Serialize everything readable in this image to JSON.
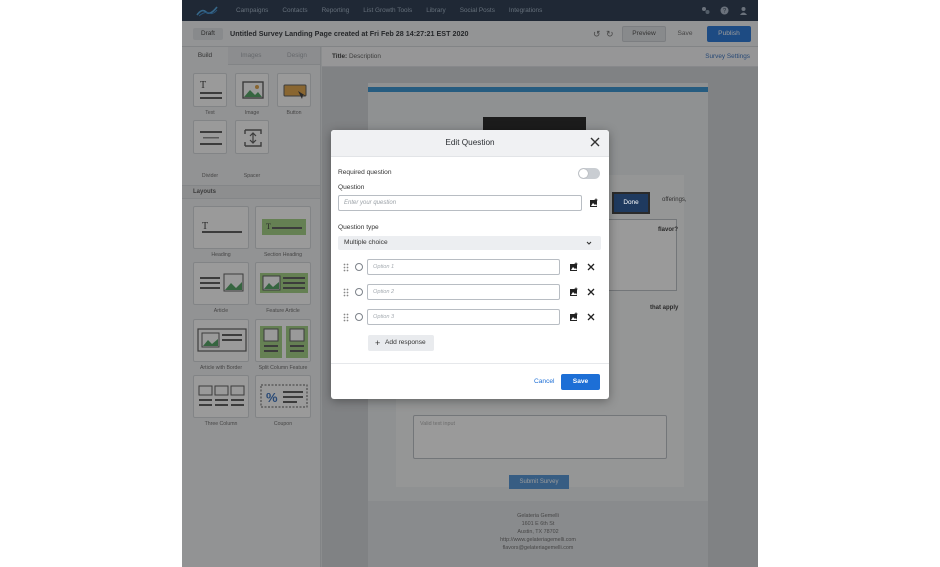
{
  "nav": {
    "items": [
      "Campaigns",
      "Contacts",
      "Reporting",
      "List Growth Tools",
      "Library",
      "Social Posts",
      "Integrations"
    ],
    "icons": [
      "apps-icon",
      "help-icon",
      "user-icon"
    ]
  },
  "toolbar": {
    "status": "Draft",
    "title": "Untitled Survey Landing Page created at Fri Feb 28 14:27:21 EST 2020",
    "preview_label": "Preview",
    "save_label": "Save",
    "publish_label": "Publish"
  },
  "left_panel": {
    "tabs": [
      "Build",
      "Images",
      "Design"
    ],
    "blocks": [
      "Text",
      "Image",
      "Button",
      "Divider",
      "Spacer"
    ],
    "layouts_heading": "Layouts",
    "layouts": [
      "Heading",
      "Section Heading",
      "Article",
      "Feature Article",
      "Article with Border",
      "Split Column Feature",
      "Three Column",
      "Coupon"
    ]
  },
  "canvas": {
    "title_label": "Title:",
    "title_value": "Description",
    "settings_link": "Survey Settings",
    "done_label": "Done",
    "peek_offerings": "offerings,",
    "peek_flavor": "flavor?",
    "peek_apply": "that apply",
    "textarea_placeholder": "Valid text input",
    "submit_label": "Submit Survey",
    "footer": [
      "Gelateria Gemelli",
      "1601 E 6th St",
      "Austin, TX 78702",
      "http://www.gelateriagemelli.com",
      "flavors@gelateriagemelli.com"
    ]
  },
  "modal": {
    "title": "Edit Question",
    "required_label": "Required question",
    "question_label": "Question",
    "question_placeholder": "Enter your question",
    "type_label": "Question type",
    "type_value": "Multiple choice",
    "options": [
      "Option 1",
      "Option 2",
      "Option 3"
    ],
    "add_response_label": "Add response",
    "cancel_label": "Cancel",
    "save_label": "Save"
  }
}
